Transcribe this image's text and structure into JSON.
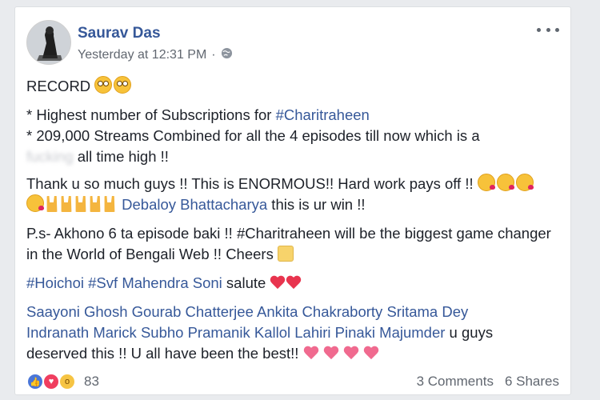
{
  "post": {
    "author": "Saurav Das",
    "time": "Yesterday at 12:31 PM",
    "separator": "·",
    "line1": "RECORD",
    "bullet1_prefix": "* Highest number of Subscriptions for ",
    "bullet1_tag": "#Charitraheen",
    "bullet2": "* 209,000 Streams Combined for all the 4 episodes till now which is a",
    "blurred_word": "fucking",
    "all_time_high": " all time high !!",
    "thanks": "Thank u so much guys !! This is ENORMOUS!! Hard work pays off !!",
    "mention": "Debaloy Bhattacharya",
    "win": " this is ur win !!",
    "ps": "P.s- Akhono 6 ta episode baki !! #Charitraheen will be the biggest game changer in the World of Bengali Web !! Cheers",
    "tags": [
      "#Hoichoi",
      "#Svf",
      "Mahendra Soni"
    ],
    "salute": " salute",
    "names1": [
      "Saayoni Ghosh",
      "Gourab Chatterjee",
      "Ankita Chakraborty",
      "Sritama Dey"
    ],
    "names2": [
      "Indranath Marick",
      "Subho Pramanik",
      "Kallol Lahiri",
      "Pinaki Majumder"
    ],
    "names2_suffix": " u guys",
    "deserved": "deserved this !! U all have been the best!!"
  },
  "reactions": {
    "count": "83",
    "comments": "3 Comments",
    "shares": "6 Shares",
    "icons": [
      "like-icon",
      "love-icon",
      "wow-icon"
    ]
  },
  "icons": {
    "globe": "globe-icon",
    "more": "more-options-icon"
  }
}
